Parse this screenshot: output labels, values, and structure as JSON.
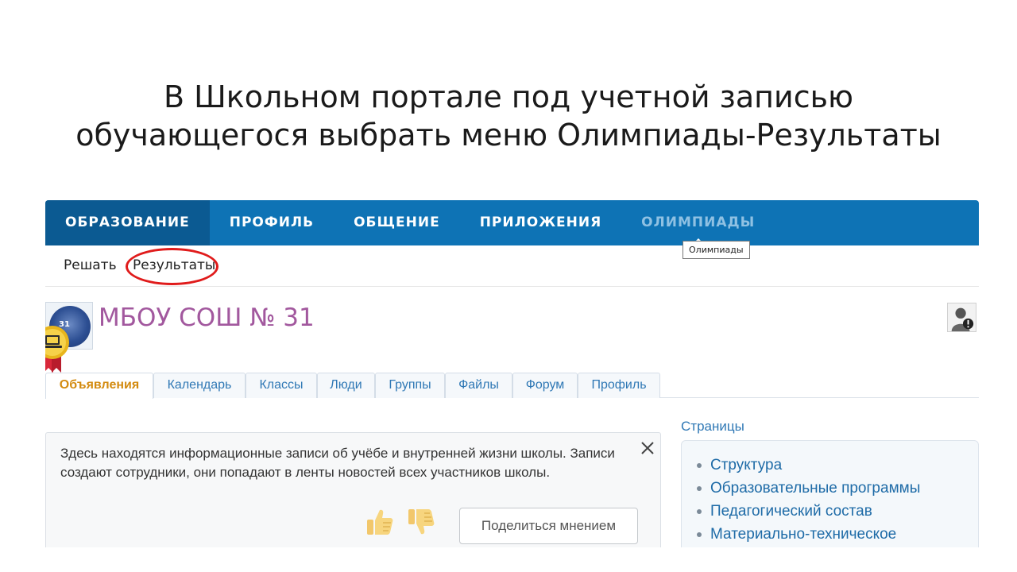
{
  "slide": {
    "title_line1": "В Школьном портале под учетной записью",
    "title_line2": "обучающегося выбрать меню Олимпиады-Результаты"
  },
  "topnav": {
    "items": [
      {
        "label": "ОБРАЗОВАНИЕ"
      },
      {
        "label": "ПРОФИЛЬ"
      },
      {
        "label": "ОБЩЕНИЕ"
      },
      {
        "label": "ПРИЛОЖЕНИЯ"
      },
      {
        "label": "ОЛИМПИАДЫ"
      }
    ],
    "active_color": "#0b5a92",
    "bar_color": "#0e73b5"
  },
  "subnav": {
    "items": [
      {
        "label": "Решать"
      },
      {
        "label": "Результаты"
      }
    ],
    "tooltip": "Олимпиады",
    "highlight_color": "#e01b1b"
  },
  "school": {
    "name": "МБОУ СОШ № 31",
    "logo_text": "31",
    "name_color": "#a2589e"
  },
  "tabs": [
    {
      "label": "Объявления"
    },
    {
      "label": "Календарь"
    },
    {
      "label": "Классы"
    },
    {
      "label": "Люди"
    },
    {
      "label": "Группы"
    },
    {
      "label": "Файлы"
    },
    {
      "label": "Форум"
    },
    {
      "label": "Профиль"
    }
  ],
  "info": {
    "text": "Здесь находятся информационные записи об учёбе и внутренней жизни школы. Записи создают сотрудники, они попадают в ленты новостей всех участников школы.",
    "feedback_button": "Поделиться мнением"
  },
  "pages": {
    "title": "Страницы",
    "items": [
      {
        "label": "Структура"
      },
      {
        "label": "Образовательные программы"
      },
      {
        "label": "Педагогический состав"
      },
      {
        "label": "Материально-техническое"
      }
    ]
  }
}
